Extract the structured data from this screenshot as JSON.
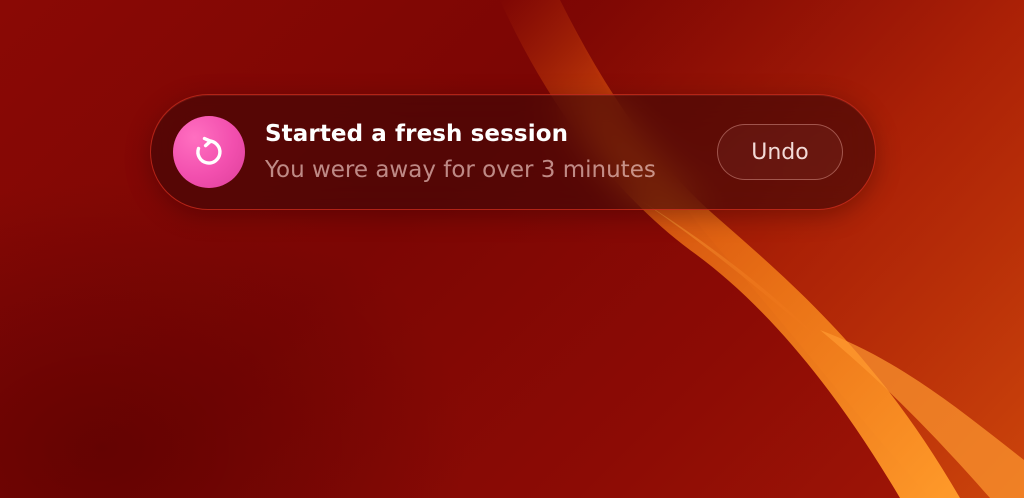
{
  "wallpaper": {
    "description_icon": "wave-wallpaper"
  },
  "toast": {
    "icon": "refresh-icon",
    "icon_color": "#f24fae",
    "title": "Started a fresh session",
    "subtitle": "You were away for over 3 minutes",
    "action_label": "Undo"
  }
}
